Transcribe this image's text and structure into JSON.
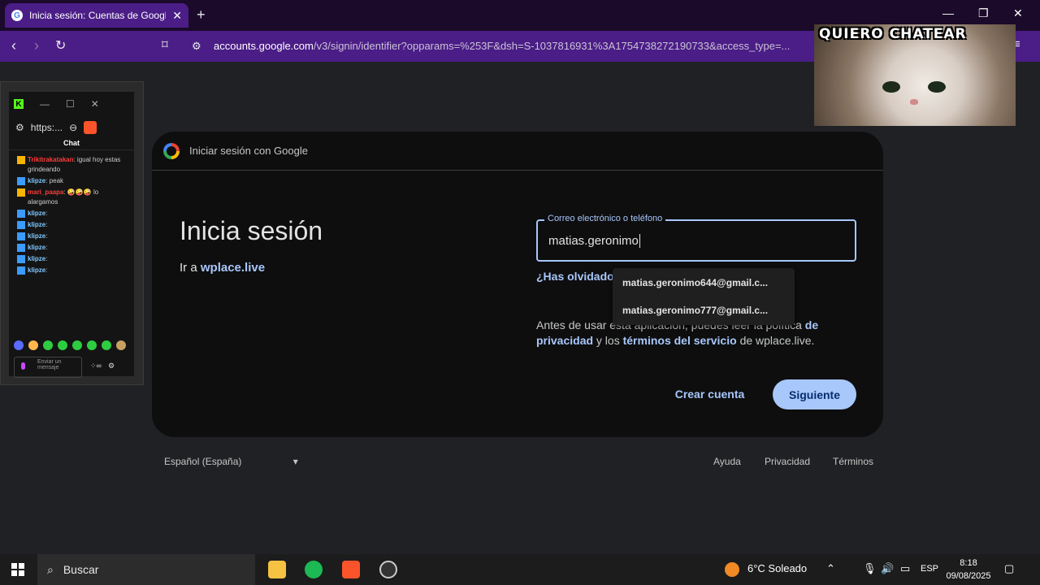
{
  "browser": {
    "tab_title": "Inicia sesión: Cuentas de Google",
    "url_domain": "accounts.google.com",
    "url_rest": "/v3/signin/identifier?opparams=%253F&dsh=S-1037816931%3A1754738272190733&access_type=..."
  },
  "overlay": {
    "caption": "QUIERO CHATEAR"
  },
  "chat_window": {
    "url": "https:...",
    "title": "Chat",
    "messages": [
      {
        "user": "Trikitrakatakan",
        "text": ": igual hoy estas grindeando",
        "user_style": "red"
      },
      {
        "user": "klipze",
        "text": ": peak",
        "user_style": "blue"
      },
      {
        "user": "mari_paapa",
        "text": ": 🤪🤪🤪 lo alargamos",
        "user_style": "red"
      },
      {
        "user": "klipze",
        "text": ":",
        "user_style": "blue"
      },
      {
        "user": "klipze",
        "text": ":",
        "user_style": "blue"
      },
      {
        "user": "klipze",
        "text": ":",
        "user_style": "blue"
      },
      {
        "user": "klipze",
        "text": ":",
        "user_style": "blue"
      },
      {
        "user": "klipze",
        "text": ":",
        "user_style": "blue"
      },
      {
        "user": "klipze",
        "text": ":",
        "user_style": "blue"
      }
    ],
    "input_placeholder": "Enviar un mensaje"
  },
  "signin": {
    "header": "Iniciar sesión con Google",
    "title": "Inicia sesión",
    "subtitle_prefix": "Ir a",
    "subtitle_link": "wplace.live",
    "field_label": "Correo electrónico o teléfono",
    "field_value": "matias.geronimo",
    "forgot": "¿Has olvidado t",
    "suggestions": [
      "matias.geronimo644@gmail.c...",
      "matias.geronimo777@gmail.c..."
    ],
    "info_1": "Antes de usar esta aplicación, puedes leer la política",
    "info_de": "de",
    "info_privacy": "privacidad",
    "info_and": "y los",
    "info_terms": "términos del servicio",
    "info_end": "de wplace.live.",
    "create_account": "Crear cuenta",
    "next": "Siguiente"
  },
  "footer": {
    "language": "Español (España)",
    "help": "Ayuda",
    "privacy": "Privacidad",
    "terms": "Términos"
  },
  "taskbar": {
    "search": "Buscar",
    "weather": "6°C Soleado",
    "lang": "ESP",
    "time": "8:18",
    "date": "09/08/2025"
  }
}
